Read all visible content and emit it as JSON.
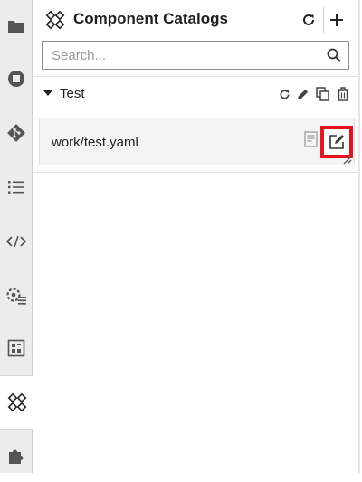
{
  "activity_bar": {
    "items": [
      {
        "icon": "folder-icon"
      },
      {
        "icon": "stop-circle-icon"
      },
      {
        "icon": "git-icon"
      },
      {
        "icon": "list-icon"
      },
      {
        "icon": "code-icon"
      },
      {
        "icon": "settings-list-icon"
      },
      {
        "icon": "property-inspector-icon"
      },
      {
        "icon": "component-catalog-icon",
        "active": true
      },
      {
        "icon": "extension-puzzle-icon"
      }
    ]
  },
  "panel": {
    "title": "Component Catalogs",
    "search_placeholder": "Search...",
    "catalogs": [
      {
        "name": "Test",
        "expanded": true,
        "entries": [
          {
            "name": "work/test.yaml"
          }
        ]
      }
    ]
  },
  "colors": {
    "accent_highlight": "#e8141b",
    "activity_bar_bg": "#ececec",
    "card_bg": "#f4f4f4"
  }
}
